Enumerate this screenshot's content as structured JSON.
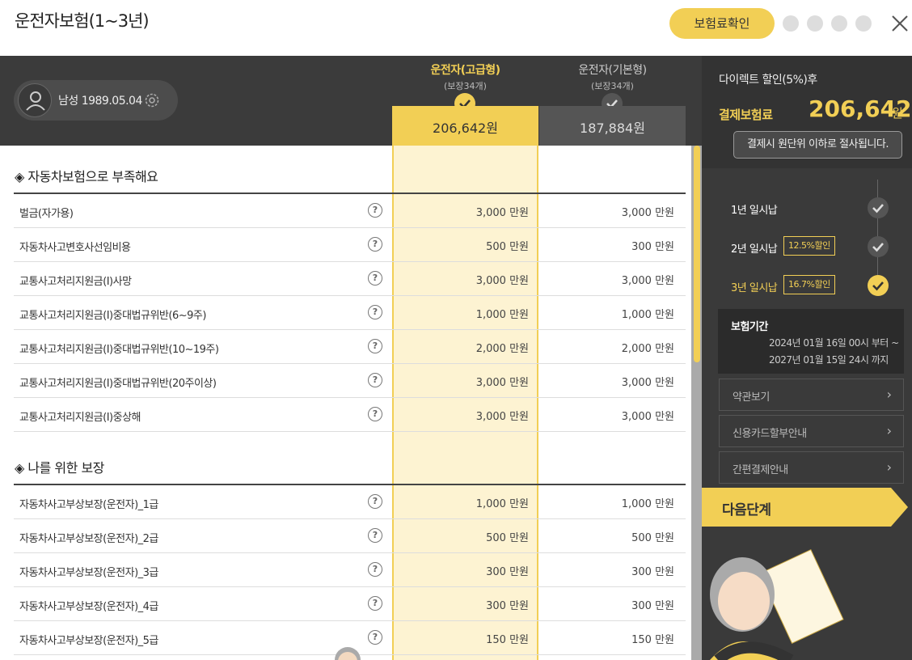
{
  "header": {
    "title": "운전자보험(1~3년)",
    "check_button": "보험료확인"
  },
  "user": {
    "info": "남성 1989.05.04"
  },
  "plans": [
    {
      "name": "운전자(고급형)",
      "sub": "(보장34개)",
      "price": "206,642원",
      "selected": true
    },
    {
      "name": "운전자(기본형)",
      "sub": "(보장34개)",
      "price": "187,884원",
      "selected": false
    }
  ],
  "sections": [
    {
      "title": "◈ 자동차보험으로 부족해요",
      "rows": [
        {
          "label": "벌금(자가용)",
          "v1": "3,000 만원",
          "v2": "3,000 만원"
        },
        {
          "label": "자동차사고변호사선임비용",
          "v1": "500 만원",
          "v2": "300 만원"
        },
        {
          "label": "교통사고처리지원금(I)사망",
          "v1": "3,000 만원",
          "v2": "3,000 만원"
        },
        {
          "label": "교통사고처리지원금(I)중대법규위반(6~9주)",
          "v1": "1,000 만원",
          "v2": "1,000 만원"
        },
        {
          "label": "교통사고처리지원금(I)중대법규위반(10~19주)",
          "v1": "2,000 만원",
          "v2": "2,000 만원"
        },
        {
          "label": "교통사고처리지원금(I)중대법규위반(20주이상)",
          "v1": "3,000 만원",
          "v2": "3,000 만원"
        },
        {
          "label": "교통사고처리지원금(I)중상해",
          "v1": "3,000 만원",
          "v2": "3,000 만원"
        }
      ]
    },
    {
      "title": "◈ 나를 위한 보장",
      "rows": [
        {
          "label": "자동차사고부상보장(운전자)_1급",
          "v1": "1,000 만원",
          "v2": "1,000 만원"
        },
        {
          "label": "자동차사고부상보장(운전자)_2급",
          "v1": "500 만원",
          "v2": "500 만원"
        },
        {
          "label": "자동차사고부상보장(운전자)_3급",
          "v1": "300 만원",
          "v2": "300 만원"
        },
        {
          "label": "자동차사고부상보장(운전자)_4급",
          "v1": "300 만원",
          "v2": "300 만원"
        },
        {
          "label": "자동차사고부상보장(운전자)_5급",
          "v1": "150 만원",
          "v2": "150 만원"
        }
      ]
    }
  ],
  "summary": {
    "discount_label": "다이렉트 할인(5%)후",
    "pay_label": "결제보험료",
    "pay_amount": "206,642",
    "won": "원",
    "tooltip": "결제시 원단위 이하로 절사됩니다."
  },
  "terms": [
    {
      "label": "1년 일시납",
      "badge": "",
      "active": false
    },
    {
      "label": "2년 일시납",
      "badge": "12.5%할인",
      "active": false
    },
    {
      "label": "3년 일시납",
      "badge": "16.7%할인",
      "active": true
    }
  ],
  "period": {
    "title": "보험기간",
    "from": "2024년 01월 16일 00시 부터 ~",
    "to": "2027년 01월 15일 24시 까지"
  },
  "links": [
    "약관보기",
    "신용카드할부안내",
    "간편결제안내"
  ],
  "next_button": "다음단계",
  "colors": {
    "accent": "#f2cf55",
    "dark": "#3b3b3b",
    "highlight": "#fdf3d2"
  }
}
